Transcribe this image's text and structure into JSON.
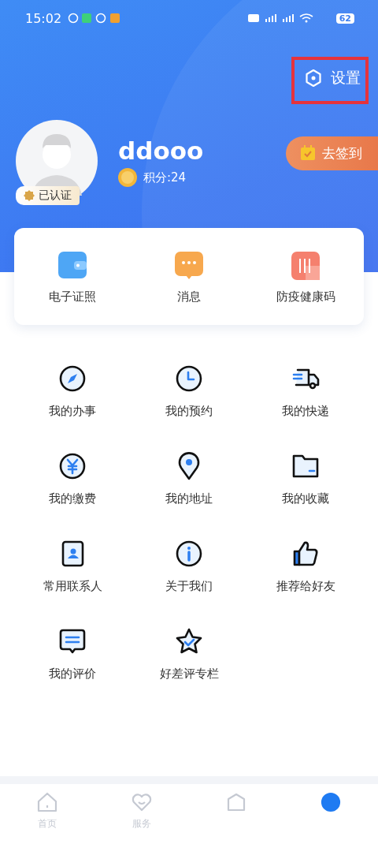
{
  "status_bar": {
    "time": "15:02",
    "battery": "62"
  },
  "settings": {
    "label": "设置",
    "highlighted": true
  },
  "profile": {
    "name": "ddooo",
    "verified_label": "已认证",
    "points": "积分:24",
    "checkin_label": "去签到"
  },
  "quick_links": [
    {
      "kind": "wallet",
      "label": "电子证照"
    },
    {
      "kind": "message",
      "label": "消息"
    },
    {
      "kind": "health",
      "label": "防疫健康码"
    }
  ],
  "menu": [
    {
      "kind": "compass",
      "label": "我的办事"
    },
    {
      "kind": "clock",
      "label": "我的预约"
    },
    {
      "kind": "truck",
      "label": "我的快递"
    },
    {
      "kind": "yen",
      "label": "我的缴费"
    },
    {
      "kind": "pin",
      "label": "我的地址"
    },
    {
      "kind": "folder",
      "label": "我的收藏"
    },
    {
      "kind": "contact",
      "label": "常用联系人"
    },
    {
      "kind": "info",
      "label": "关于我们"
    },
    {
      "kind": "thumb",
      "label": "推荐给好友"
    },
    {
      "kind": "comment",
      "label": "我的评价"
    },
    {
      "kind": "star",
      "label": "好差评专栏"
    }
  ],
  "tab_bar": [
    {
      "kind": "home",
      "label": "首页",
      "selected": false
    },
    {
      "kind": "heart",
      "label": "服务",
      "selected": false
    },
    {
      "kind": "box",
      "selected": false
    },
    {
      "kind": "person",
      "selected": true
    }
  ]
}
